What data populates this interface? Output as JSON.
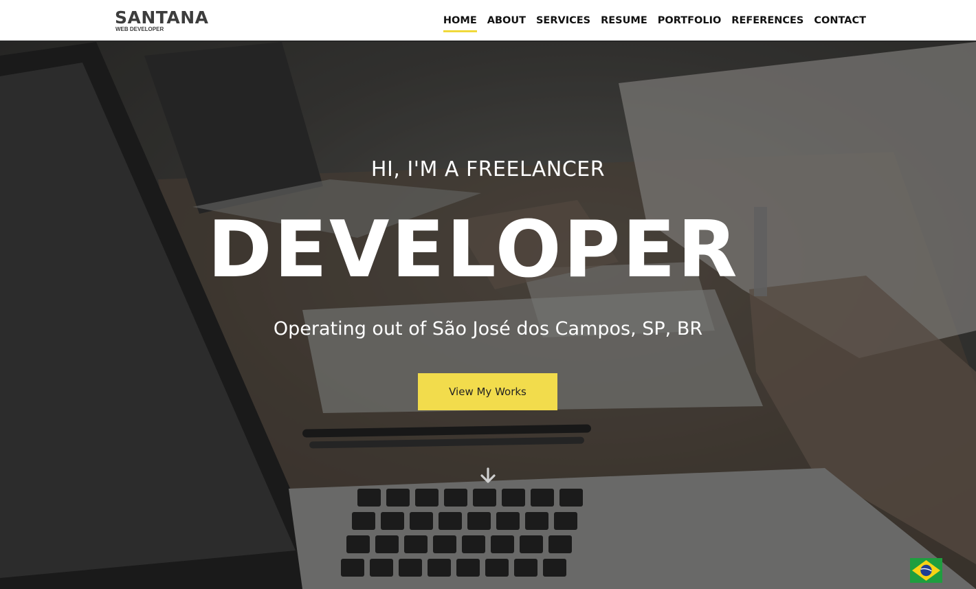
{
  "brand": {
    "name": "SANTANA",
    "tagline": "WEB DEVELOPER"
  },
  "nav": {
    "items": [
      {
        "label": "HOME",
        "active": true
      },
      {
        "label": "ABOUT"
      },
      {
        "label": "SERVICES"
      },
      {
        "label": "RESUME"
      },
      {
        "label": "PORTFOLIO"
      },
      {
        "label": "REFERENCES"
      },
      {
        "label": "CONTACT"
      }
    ]
  },
  "hero": {
    "pretitle": "HI, I'M A FREELANCER",
    "title": "DEVELOPER",
    "subtitle": "Operating out of São José dos Campos, SP, BR",
    "cta_label": "View My Works",
    "scroll_icon": "arrow-down-icon",
    "language_icon": "brazil-flag-icon"
  },
  "colors": {
    "accent": "#f2dc4c",
    "nav_text": "#111111",
    "hero_text": "#ffffff"
  }
}
